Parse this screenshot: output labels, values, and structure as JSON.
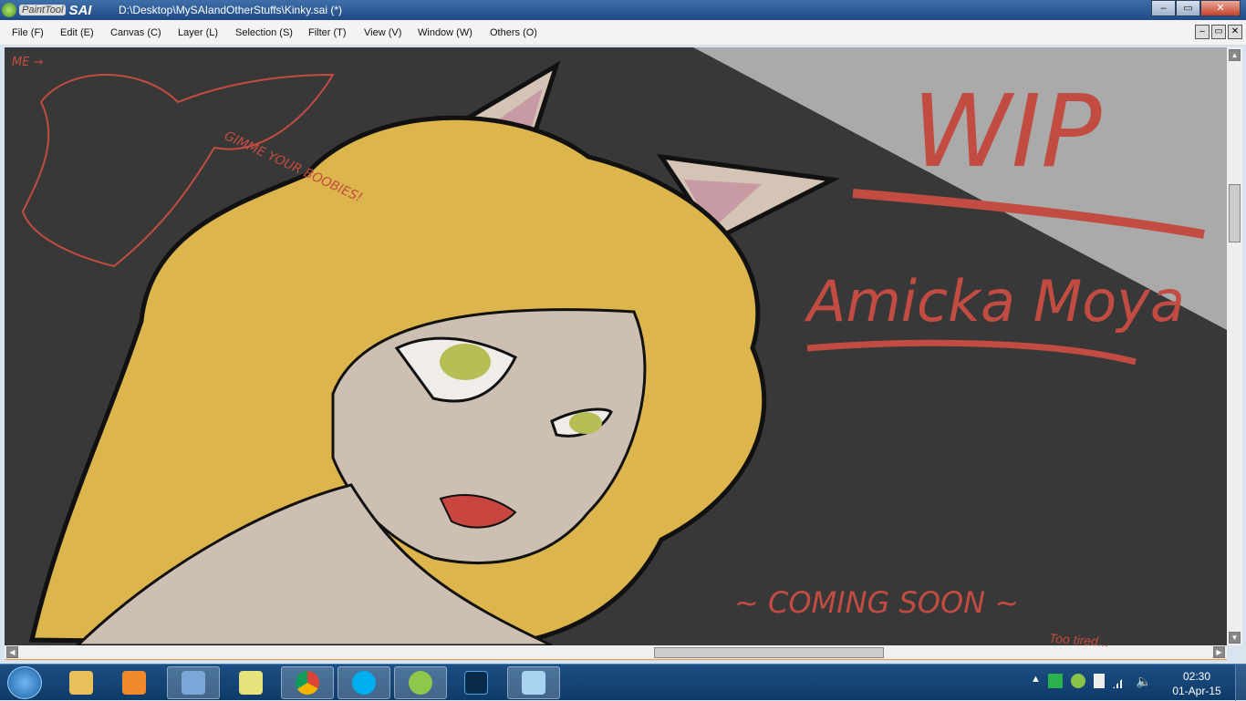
{
  "window": {
    "app_name_small": "PaintTool",
    "app_name_big": "SAI",
    "title": "D:\\Desktop\\MySAIandOtherStuffs\\Kinky.sai (*)",
    "min": "‒",
    "max": "▭",
    "close": "✕"
  },
  "menu": [
    {
      "label": "File (F)"
    },
    {
      "label": "Edit (E)"
    },
    {
      "label": "Canvas (C)"
    },
    {
      "label": "Layer (L)"
    },
    {
      "label": "Selection (S)"
    },
    {
      "label": "Filter (T)"
    },
    {
      "label": "View (V)"
    },
    {
      "label": "Window (W)"
    },
    {
      "label": "Others (O)"
    }
  ],
  "artwork": {
    "wip": "WIP",
    "name": "Amicka Moya",
    "coming": "~ COMING SOON ~",
    "me": "ME →",
    "gimme": "GIMME YOUR BOOBIES!",
    "tired": "Too tired..."
  },
  "taskbar": {
    "apps": [
      {
        "name": "windows-explorer",
        "color": "#e8c15a"
      },
      {
        "name": "media-player",
        "color": "#f08a2c"
      },
      {
        "name": "keyboard-app",
        "color": "#7aa7d8"
      },
      {
        "name": "sticky-notes",
        "color": "#e6e37a"
      },
      {
        "name": "chrome",
        "color": "#db4437"
      },
      {
        "name": "skype",
        "color": "#00aff0"
      },
      {
        "name": "painttool-sai",
        "color": "#8fc74a"
      },
      {
        "name": "photoshop",
        "color": "#0b2a4a"
      },
      {
        "name": "notepad",
        "color": "#a9d3f0"
      }
    ],
    "time": "02:30",
    "date": "01-Apr-15"
  }
}
